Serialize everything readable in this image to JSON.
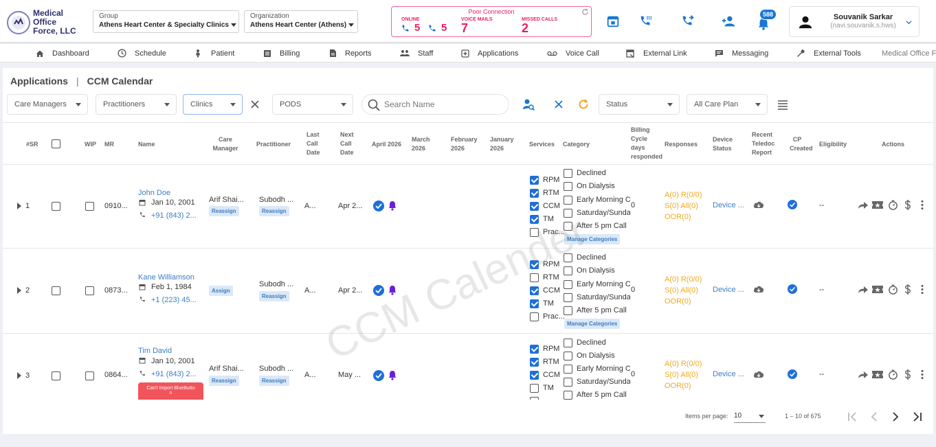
{
  "header": {
    "logo_line1": "Medical Office",
    "logo_line2": "Force, LLC",
    "group_label": "Group",
    "group_value": "Athens Heart Center & Specialty Clinics",
    "org_label": "Organization",
    "org_value": "Athens Heart Center (Athens)",
    "connection": {
      "title": "Poor Connection",
      "online_label": "ONLINE",
      "online_count_a": "5",
      "online_count_b": "5",
      "voicemail_label": "VOICE MAILS",
      "voicemail_count": "7",
      "missed_label": "MISSED CALLS",
      "missed_count": "2"
    },
    "notification_count": "588",
    "user_name": "Souvanik Sarkar",
    "user_email": "(navi.souvanik.s.hws)"
  },
  "nav": [
    {
      "label": "Dashboard",
      "icon": "home-icon"
    },
    {
      "label": "Schedule",
      "icon": "clock-icon"
    },
    {
      "label": "Patient",
      "icon": "patient-icon"
    },
    {
      "label": "Billing",
      "icon": "billing-icon"
    },
    {
      "label": "Reports",
      "icon": "reports-icon"
    },
    {
      "label": "Staff",
      "icon": "staff-icon"
    },
    {
      "label": "Applications",
      "icon": "applications-icon"
    },
    {
      "label": "Voice Call",
      "icon": "voicemail-icon"
    },
    {
      "label": "External Link",
      "icon": "external-link-icon"
    },
    {
      "label": "Messaging",
      "icon": "message-icon"
    },
    {
      "label": "External Tools",
      "icon": "wrench-icon"
    },
    {
      "label": "Medical Office Fo",
      "icon": ""
    }
  ],
  "breadcrumb": {
    "first": "Applications",
    "separator": "|",
    "second": "CCM Calendar"
  },
  "filters": {
    "care_managers": "Care Managers",
    "practitioners": "Practitioners",
    "clinics": "Clinics",
    "pods": "PODS",
    "search_placeholder": "Search Name",
    "status": "Status",
    "care_plan": "All Care Plan"
  },
  "columns": {
    "sr": "#SR",
    "wip": "WIP",
    "mr": "MR",
    "name": "Name",
    "care_manager": [
      "Care",
      "Manager"
    ],
    "practitioner": "Practitioner",
    "last_call": [
      "Last",
      "Call",
      "Date"
    ],
    "next_call": [
      "Next",
      "Call",
      "Date"
    ],
    "m1": "April 2026",
    "m2": [
      "March",
      "2026"
    ],
    "m3": [
      "February",
      "2026"
    ],
    "m4": [
      "January",
      "2026"
    ],
    "services": "Services",
    "category": "Category",
    "billing": [
      "Billing",
      "Cycle",
      "days",
      "responded"
    ],
    "responses": "Responses",
    "device": [
      "Device",
      "Status"
    ],
    "teledoc": [
      "Recent",
      "Teledoc",
      "Report"
    ],
    "cp": [
      "CP",
      "Created"
    ],
    "eligibility": "Eligibility",
    "actions": "Actions"
  },
  "rows": [
    {
      "sr": "1",
      "mr": "0910...",
      "name": "John Doe",
      "dob": "Jan 10, 2001",
      "phone": "+91 (843) 2...",
      "care_manager": "Arif Shai...",
      "cm_action": "Reassign",
      "practitioner": "Subodh ...",
      "pr_action": "Reassign",
      "last_call": "A...",
      "next_call": "Apr 2...",
      "services": [
        {
          "label": "RPM",
          "checked": true
        },
        {
          "label": "RTM",
          "checked": true
        },
        {
          "label": "CCM",
          "checked": true
        },
        {
          "label": "TM",
          "checked": true
        },
        {
          "label": "Prac...",
          "checked": false
        }
      ],
      "categories": [
        "Declined",
        "On Dialysis",
        "Early Morning C",
        "Saturday/Sunda",
        "After 5 pm Call"
      ],
      "manage": "Manage Categories",
      "billing_days": "0",
      "responses": [
        "A(0) R(0/0)",
        "S(0) All(0)",
        "OOR(0)"
      ],
      "device": "Device ...",
      "eligibility": "--"
    },
    {
      "sr": "2",
      "mr": "0873...",
      "name": "Kane Williamson",
      "dob": "Feb 1, 1984",
      "phone": "+1 (223) 45...",
      "care_manager": "",
      "cm_action": "Assign",
      "practitioner": "Subodh ...",
      "pr_action": "Reassign",
      "last_call": "A...",
      "next_call": "Apr 2...",
      "services": [
        {
          "label": "RPM",
          "checked": true
        },
        {
          "label": "RTM",
          "checked": false
        },
        {
          "label": "CCM",
          "checked": true
        },
        {
          "label": "TM",
          "checked": true
        },
        {
          "label": "Prac...",
          "checked": false
        }
      ],
      "categories": [
        "Declined",
        "On Dialysis",
        "Early Morning C",
        "Saturday/Sunda",
        "After 5 pm Call"
      ],
      "manage": "Manage Categories",
      "billing_days": "0",
      "responses": [
        "A(0) R(0/0)",
        "S(0) All(0)",
        "OOR(0)"
      ],
      "device": "Device ...",
      "eligibility": "--"
    },
    {
      "sr": "3",
      "mr": "0864...",
      "name": "Tim David",
      "dob": "Jan 10, 2001",
      "phone": "+91 (843) 2...",
      "care_manager": "Arif Shai...",
      "cm_action": "Reassign",
      "practitioner": "Subodh ...",
      "pr_action": "Reassign",
      "last_call": "A...",
      "next_call": "May ...",
      "services": [
        {
          "label": "RPM",
          "checked": true
        },
        {
          "label": "RTM",
          "checked": true
        },
        {
          "label": "CCM",
          "checked": true
        },
        {
          "label": "TM",
          "checked": false
        },
        {
          "label": "",
          "checked": false
        }
      ],
      "categories": [
        "Declined",
        "On Dialysis",
        "Early Morning C",
        "Saturday/Sunda",
        "After 5 pm Call"
      ],
      "manage": "",
      "billing_days": "0",
      "responses": [
        "A(0) R(0/0)",
        "S(0) All(0)",
        "OOR(0)"
      ],
      "device": "Device ...",
      "eligibility": "--",
      "error_line1": "Can't Import BlueButto",
      "error_line2": "n"
    }
  ],
  "watermark": "CCM Calender",
  "pagination": {
    "items_per_page_label": "Items per page:",
    "items_per_page": "10",
    "range": "1 – 10 of 675"
  },
  "colors": {
    "accent": "#1e6fd9",
    "alert": "#e91e63",
    "link": "#3b7dc4",
    "responses": "#f0a820",
    "bell": "#6a1fd6"
  }
}
